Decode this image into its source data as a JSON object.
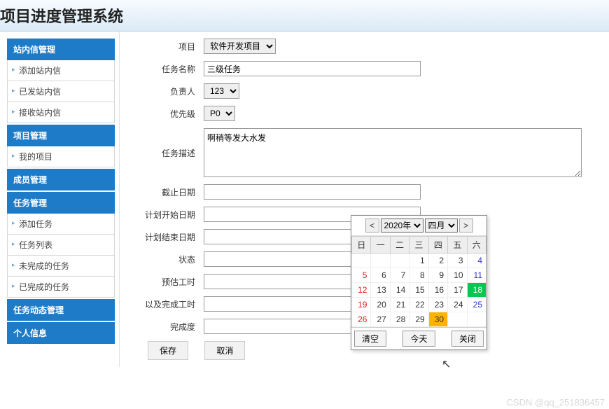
{
  "header": {
    "title": "项目进度管理系统"
  },
  "sidebar": {
    "sections": [
      {
        "title": "站内信管理",
        "items": [
          "添加站内信",
          "已发站内信",
          "接收站内信"
        ]
      },
      {
        "title": "项目管理",
        "items": [
          "我的项目"
        ]
      },
      {
        "title": "成员管理",
        "items": []
      },
      {
        "title": "任务管理",
        "items": [
          "添加任务",
          "任务列表",
          "未完成的任务",
          "已完成的任务"
        ]
      },
      {
        "title": "任务动态管理",
        "items": []
      },
      {
        "title": "个人信息",
        "items": []
      }
    ]
  },
  "form": {
    "project": {
      "label": "项目",
      "value": "软件开发项目"
    },
    "taskName": {
      "label": "任务名称",
      "value": "三级任务"
    },
    "owner": {
      "label": "负责人",
      "value": "123"
    },
    "priority": {
      "label": "优先级",
      "value": "P0"
    },
    "desc": {
      "label": "任务描述",
      "value": "啊稍等发大水发"
    },
    "deadline": {
      "label": "截止日期",
      "value": ""
    },
    "planStart": {
      "label": "计划开始日期",
      "value": ""
    },
    "planEnd": {
      "label": "计划结束日期",
      "value": ""
    },
    "status": {
      "label": "状态",
      "value": ""
    },
    "estimate": {
      "label": "预估工时",
      "value": ""
    },
    "doneHours": {
      "label": "以及完成工时",
      "value": ""
    },
    "progress": {
      "label": "完成度",
      "value": ""
    }
  },
  "buttons": {
    "save": "保存",
    "cancel": "取消"
  },
  "datepicker": {
    "prev": "<",
    "next": ">",
    "year": "2020年",
    "month": "四月",
    "dow": [
      "日",
      "一",
      "二",
      "三",
      "四",
      "五",
      "六"
    ],
    "weeks": [
      [
        "",
        "",
        "",
        "1",
        "2",
        "3",
        "4"
      ],
      [
        "5",
        "6",
        "7",
        "8",
        "9",
        "10",
        "11"
      ],
      [
        "12",
        "13",
        "14",
        "15",
        "16",
        "17",
        "18"
      ],
      [
        "19",
        "20",
        "21",
        "22",
        "23",
        "24",
        "25"
      ],
      [
        "26",
        "27",
        "28",
        "29",
        "30",
        "",
        ""
      ]
    ],
    "today_cell": "18",
    "selected_cell": "30",
    "clear": "清空",
    "today": "今天",
    "close": "关闭"
  },
  "watermark": "CSDN @qq_251836457"
}
